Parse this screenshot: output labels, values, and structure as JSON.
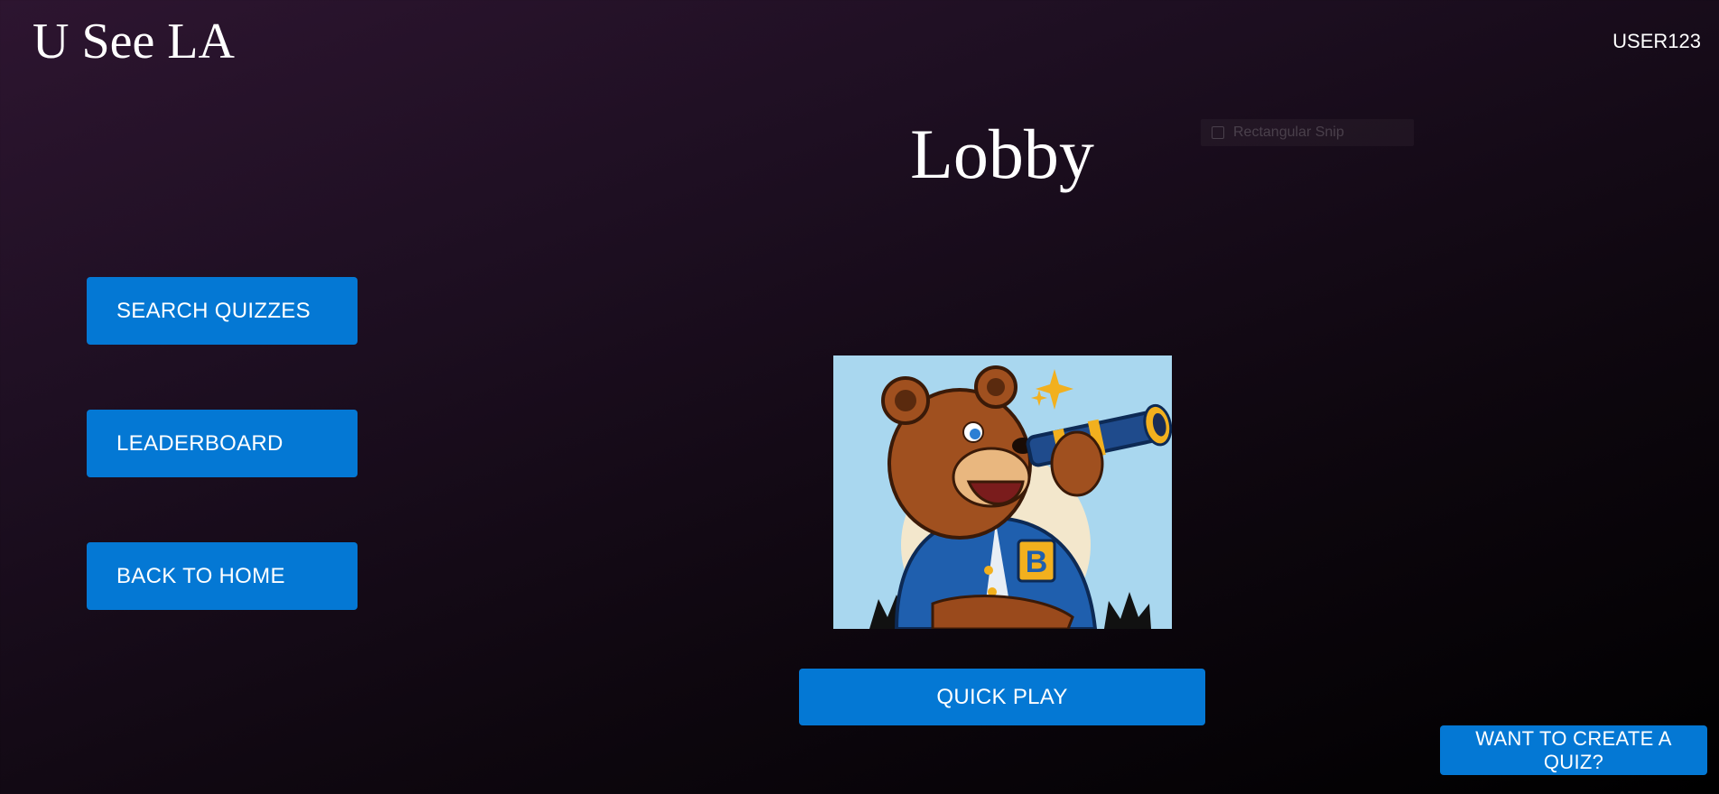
{
  "header": {
    "logo": "U See LA",
    "username": "USER123"
  },
  "page": {
    "title": "Lobby"
  },
  "overlay": {
    "snip_label": "Rectangular Snip"
  },
  "sidebar": {
    "items": [
      {
        "label": "SEARCH QUIZZES"
      },
      {
        "label": "LEADERBOARD"
      },
      {
        "label": "BACK TO HOME"
      }
    ]
  },
  "main": {
    "image_alt": "Bear mascot looking through a telescope",
    "quick_play_label": "QUICK PLAY"
  },
  "footer": {
    "create_quiz_label": "WANT TO CREATE A QUIZ?"
  },
  "colors": {
    "accent": "#0478d4",
    "background_top": "#2d1530",
    "background_bottom": "#000000"
  }
}
